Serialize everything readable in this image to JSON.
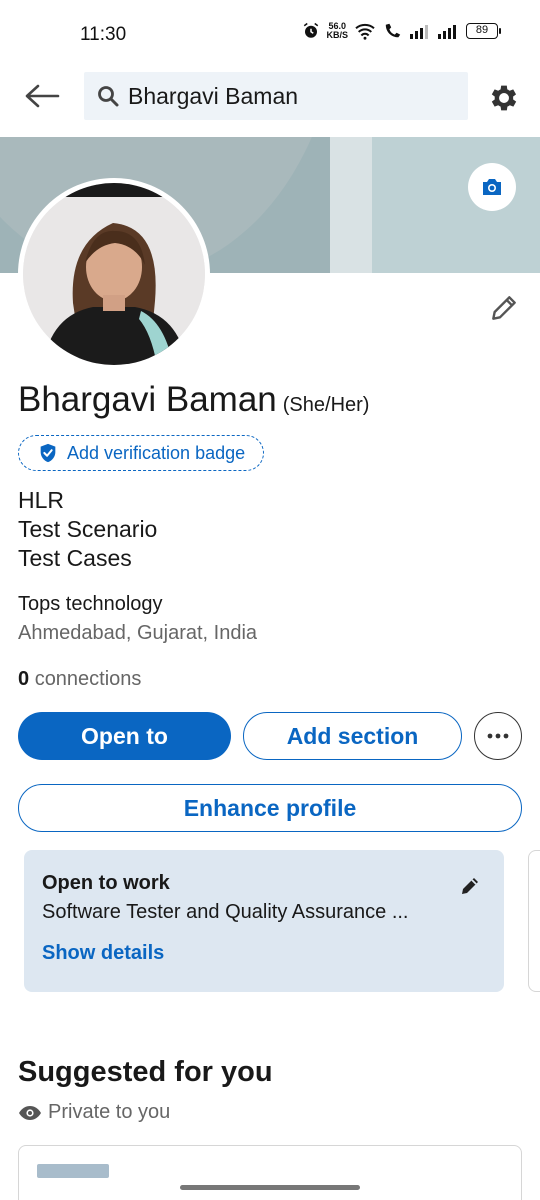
{
  "status_bar": {
    "time": "11:30",
    "net_speed_value": "56.0",
    "net_speed_unit": "KB/S",
    "battery": "89"
  },
  "top_bar": {
    "search_value": "Bhargavi Baman"
  },
  "profile": {
    "name": "Bhargavi Baman",
    "pronouns": "(She/Her)",
    "verification_label": "Add verification badge",
    "headline_lines": [
      "HLR",
      "Test Scenario",
      "Test Cases"
    ],
    "company": "Tops technology",
    "location": "Ahmedabad, Gujarat, India",
    "connections_count": "0",
    "connections_label": "connections"
  },
  "actions": {
    "open_to": "Open to",
    "add_section": "Add section",
    "enhance_profile": "Enhance profile"
  },
  "open_to_work": {
    "title": "Open to work",
    "description": "Software Tester and Quality Assurance ...",
    "link": "Show details"
  },
  "suggested": {
    "title": "Suggested for you",
    "privacy": "Private to you"
  },
  "colors": {
    "brand_blue": "#0a66c2",
    "card_bg": "#dde7f1",
    "search_bg": "#eef3f8"
  },
  "icons": [
    "back-arrow-icon",
    "search-icon",
    "gear-icon",
    "camera-icon",
    "pencil-icon",
    "shield-check-icon",
    "more-horizontal-icon",
    "eye-icon"
  ]
}
